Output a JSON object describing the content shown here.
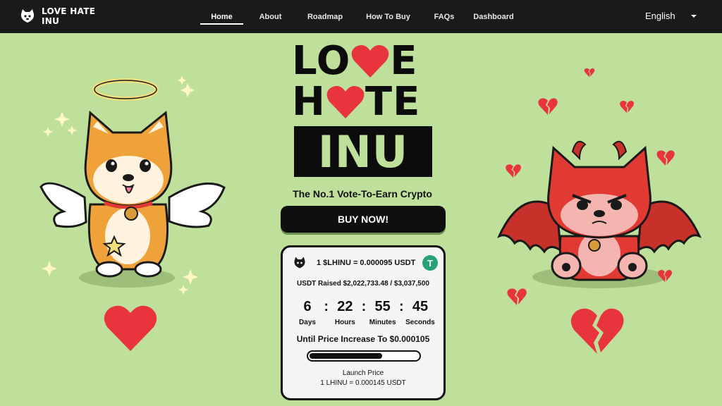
{
  "nav": {
    "brand_line1": "LOVE HATE",
    "brand_line2": "INU",
    "links": [
      "Home",
      "About",
      "Roadmap",
      "How To Buy",
      "FAQs",
      "Dashboard"
    ],
    "active": "Home",
    "language": "English"
  },
  "hero": {
    "title_line1_left": "LO",
    "title_line1_right": "E",
    "title_line2_left": "H",
    "title_line2_right": "TE",
    "title_line3": "INU",
    "tagline": "The No.1 Vote-To-Earn Crypto",
    "buy_label": "BUY NOW!"
  },
  "presale": {
    "rate": "1 $LHINU = 0.000095 USDT",
    "tether_symbol": "T",
    "raised": "USDT Raised $2,022,733.48 / $3,037,500",
    "countdown": [
      {
        "value": "6",
        "label": "Days"
      },
      {
        "value": "22",
        "label": "Hours"
      },
      {
        "value": "55",
        "label": "Minutes"
      },
      {
        "value": "45",
        "label": "Seconds"
      }
    ],
    "separator": ":",
    "until_text": "Until Price Increase To $0.000105",
    "progress_fraction": 0.67,
    "launch_label": "Launch Price",
    "launch_value": "1 LHINU = 0.000145 USDT"
  },
  "colors": {
    "background": "#bfe09b",
    "nav": "#1a1a1a",
    "heart": "#e8343c",
    "dog_orange": "#f0a23a",
    "devil_red": "#e03a33"
  },
  "icons": [
    "dog-logo-icon",
    "caret-down-icon",
    "tether-icon",
    "heart-icon",
    "broken-heart-icon",
    "sparkle-icon",
    "halo-icon"
  ]
}
